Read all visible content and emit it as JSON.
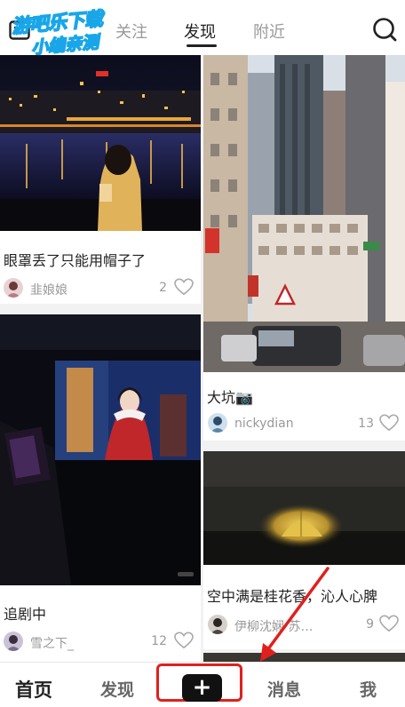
{
  "header": {
    "tabs": [
      {
        "label": "关注",
        "active": false
      },
      {
        "label": "发现",
        "active": true
      },
      {
        "label": "附近",
        "active": false
      }
    ],
    "icons": [
      "menu-icon",
      "search-icon"
    ],
    "watermark": {
      "line1": "游吧乐下载",
      "line2": "小编亲测"
    }
  },
  "feed": {
    "left": [
      {
        "title": "眼罩丢了只能用帽子了",
        "author": "韭娘娘",
        "likes": "2"
      },
      {
        "title": "追剧中",
        "author": "雪之下_",
        "likes": "12"
      }
    ],
    "right": [
      {
        "title": "大坑📷",
        "author": "nickydian",
        "likes": "13"
      },
      {
        "title": "空中满是桂花香，沁人心脾",
        "author": "伊柳沈娴 苏…",
        "likes": "9"
      }
    ]
  },
  "bottom_nav": {
    "items": [
      {
        "label": "首页",
        "active": true
      },
      {
        "label": "发现",
        "active": false
      },
      {
        "label": "+",
        "active": false
      },
      {
        "label": "消息",
        "active": false
      },
      {
        "label": "我",
        "active": false
      }
    ]
  },
  "colors": {
    "annotation": "#e0201d",
    "tab_active": "#222222",
    "tab_inactive": "#999999",
    "heart": "#bbbbbb"
  }
}
